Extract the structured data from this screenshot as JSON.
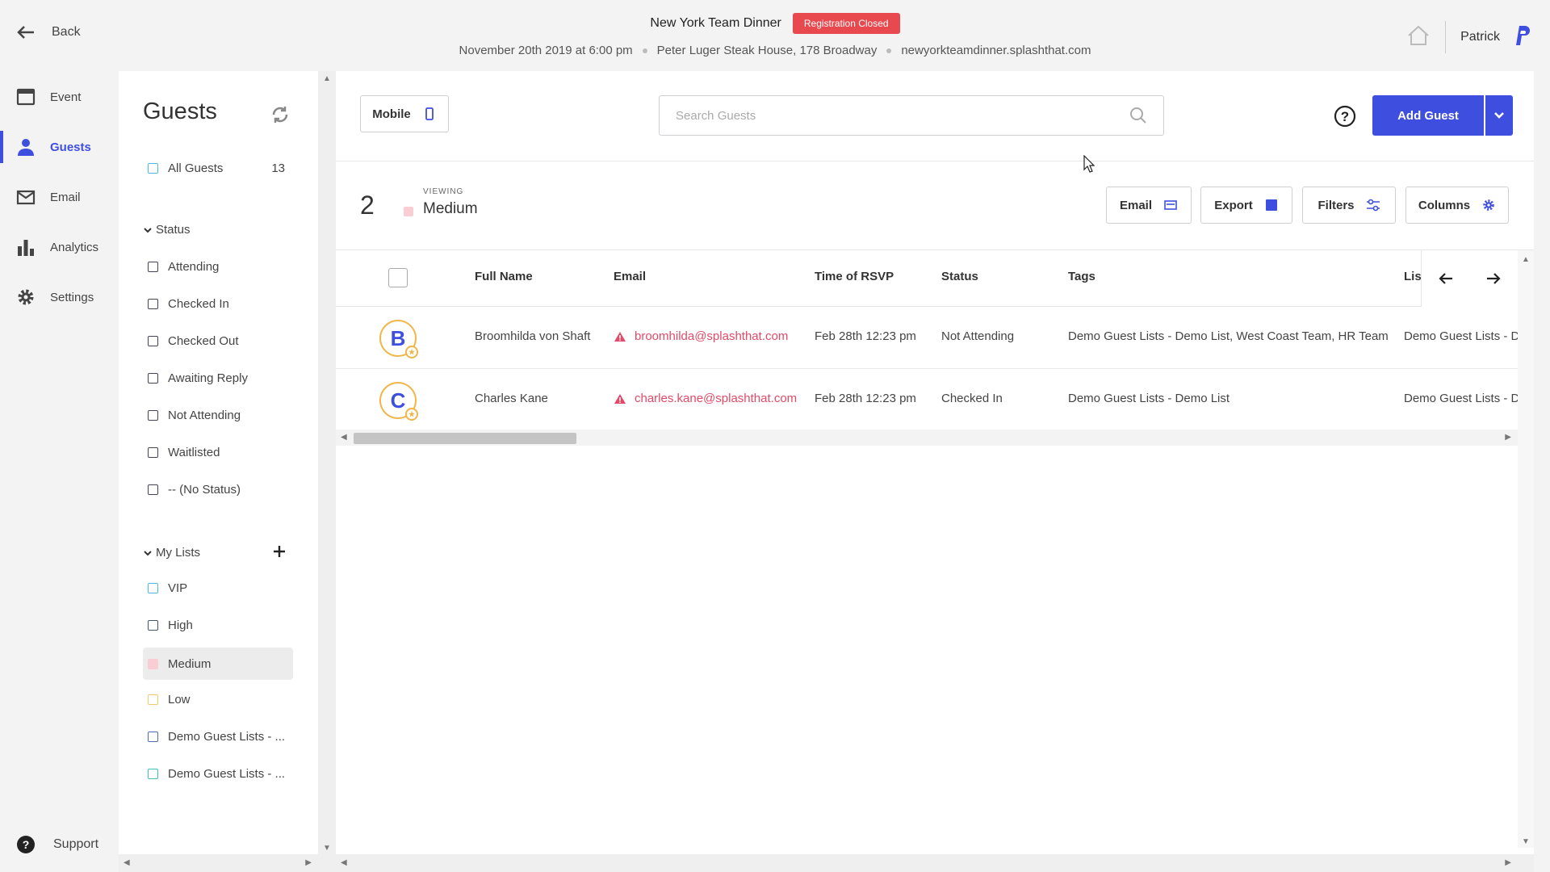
{
  "header": {
    "back_label": "Back",
    "event_name": "New York Team Dinner",
    "status_badge": "Registration Closed",
    "date": "November 20th 2019 at 6:00 pm",
    "venue": "Peter Luger Steak House, 178 Broadway",
    "url": "newyorkteamdinner.splashthat.com",
    "user_name": "Patrick"
  },
  "nav": {
    "items": [
      {
        "label": "Event",
        "icon": "calendar-icon"
      },
      {
        "label": "Guests",
        "icon": "person-icon"
      },
      {
        "label": "Email",
        "icon": "envelope-icon"
      },
      {
        "label": "Analytics",
        "icon": "bar-chart-icon"
      },
      {
        "label": "Settings",
        "icon": "gear-icon"
      }
    ],
    "support_label": "Support"
  },
  "panel": {
    "title": "Guests",
    "all_guests": {
      "label": "All Guests",
      "count": "13"
    },
    "status_header": "Status",
    "statuses": [
      "Attending",
      "Checked In",
      "Checked Out",
      "Awaiting Reply",
      "Not Attending",
      "Waitlisted",
      "-- (No Status)"
    ],
    "lists_header": "My Lists",
    "lists": [
      {
        "label": "VIP",
        "color": "#4fb8e8"
      },
      {
        "label": "High",
        "color": "#445566"
      },
      {
        "label": "Medium",
        "color": "#f8cdd3"
      },
      {
        "label": "Low",
        "color": "#f5c96a"
      },
      {
        "label": "Demo Guest Lists - ...",
        "color": "#4a6fb0"
      },
      {
        "label": "Demo Guest Lists - ...",
        "color": "#3cc0b8"
      }
    ]
  },
  "toolbar": {
    "mobile_label": "Mobile",
    "search_placeholder": "Search Guests",
    "add_guest_label": "Add Guest"
  },
  "viewbar": {
    "count": "2",
    "viewing_label": "VIEWING",
    "viewing_name": "Medium",
    "email_label": "Email",
    "export_label": "Export",
    "filters_label": "Filters",
    "columns_label": "Columns"
  },
  "table": {
    "columns": [
      "Full Name",
      "Email",
      "Time of RSVP",
      "Status",
      "Tags",
      "List"
    ],
    "rows": [
      {
        "initial": "B",
        "name": "Broomhilda von Shaft",
        "email": "broomhilda@splashthat.com",
        "rsvp": "Feb 28th 12:23 pm",
        "status": "Not Attending",
        "tags": "Demo Guest Lists - Demo List, West Coast Team, HR Team",
        "list": "Demo Guest Lists - D"
      },
      {
        "initial": "C",
        "name": "Charles Kane",
        "email": "charles.kane@splashthat.com",
        "rsvp": "Feb 28th 12:23 pm",
        "status": "Checked In",
        "tags": "Demo Guest Lists - Demo List",
        "list": "Demo Guest Lists - D"
      }
    ]
  },
  "colors": {
    "accent": "#3e4fe0",
    "badge": "#e8494f",
    "email_link": "#e44a68"
  }
}
